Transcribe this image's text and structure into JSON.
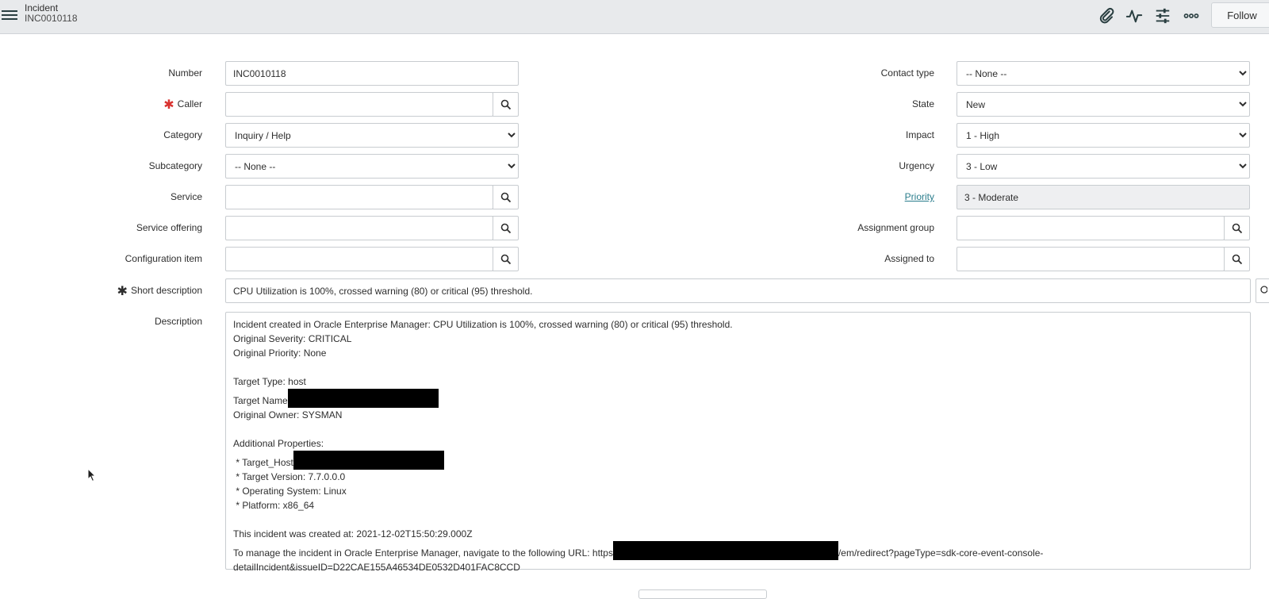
{
  "header": {
    "title": "Incident",
    "record_number": "INC0010118",
    "follow_label": "Follow",
    "icons": [
      "hamburger-icon",
      "paperclip-icon",
      "activity-icon",
      "sliders-icon",
      "more-icon"
    ]
  },
  "form": {
    "number": {
      "label": "Number",
      "value": "INC0010118"
    },
    "caller": {
      "label": "Caller",
      "value": ""
    },
    "category": {
      "label": "Category",
      "value": "Inquiry / Help"
    },
    "subcategory": {
      "label": "Subcategory",
      "value": "-- None --"
    },
    "service": {
      "label": "Service",
      "value": ""
    },
    "service_offering": {
      "label": "Service offering",
      "value": ""
    },
    "configuration_item": {
      "label": "Configuration item",
      "value": ""
    },
    "contact_type": {
      "label": "Contact type",
      "value": "-- None --"
    },
    "state": {
      "label": "State",
      "value": "New"
    },
    "impact": {
      "label": "Impact",
      "value": "1 - High"
    },
    "urgency": {
      "label": "Urgency",
      "value": "3 - Low"
    },
    "priority": {
      "label": "Priority",
      "value": "3 - Moderate"
    },
    "assignment_group": {
      "label": "Assignment group",
      "value": ""
    },
    "assigned_to": {
      "label": "Assigned to",
      "value": ""
    },
    "short_description": {
      "label": "Short description",
      "value": "CPU Utilization is 100%, crossed warning (80) or critical (95) threshold."
    },
    "description": {
      "label": "Description",
      "lines": {
        "l1": "Incident created in Oracle Enterprise Manager: CPU Utilization is 100%, crossed warning (80) or critical (95) threshold.",
        "l2": "Original Severity: CRITICAL",
        "l3": "Original Priority: None",
        "l4": "Target Type: host",
        "l5": "Target Name",
        "l6": "Original Owner: SYSMAN",
        "l7": "Additional Properties:",
        "l8": " * Target_Host",
        "l9": " * Target Version: 7.7.0.0.0",
        "l10": " * Operating System: Linux",
        "l11": " * Platform: x86_64",
        "l12": "This incident was created at: 2021-12-02T15:50:29.000Z",
        "l13a": "To manage the incident in Oracle Enterprise Manager, navigate to the following URL: https",
        "l13b": "/em/redirect?pageType=sdk-core-event-console-",
        "l14": "detailIncident&issueID=D22CAE155A46534DE0532D401FAC8CCD"
      }
    }
  },
  "colors": {
    "header_bg": "#e8eaec",
    "required_red": "#d9322f",
    "priority_link": "#2a7d8c",
    "redaction": "#000000"
  }
}
